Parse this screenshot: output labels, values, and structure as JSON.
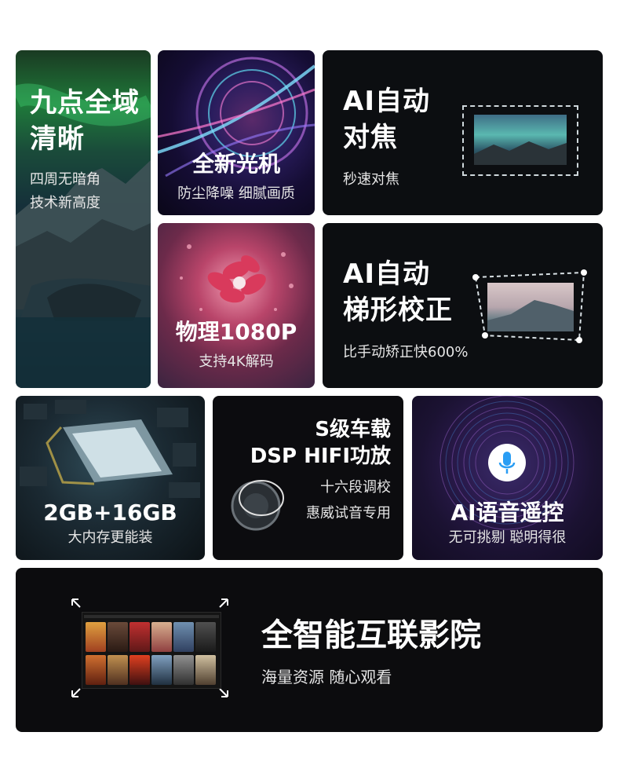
{
  "cards": {
    "clarity": {
      "title_line1": "九点全域",
      "title_line2": "清晰",
      "sub_line1": "四周无暗角",
      "sub_line2": "技术新高度"
    },
    "optics": {
      "title": "全新光机",
      "sub": "防尘降噪 细腻画质"
    },
    "autofocus": {
      "title_line1": "AI自动",
      "title_line2": "对焦",
      "sub": "秒速对焦"
    },
    "resolution": {
      "title": "物理1080P",
      "sub": "支持4K解码"
    },
    "keystone": {
      "title_line1": "AI自动",
      "title_line2": "梯形校正",
      "sub": "比手动矫正快600%"
    },
    "memory": {
      "title": "2GB+16GB",
      "sub": "大内存更能装"
    },
    "audio": {
      "title_line1": "S级车载",
      "title_line2": "DSP HIFI功放",
      "sub_line1": "十六段调校",
      "sub_line2": "惠威试音专用"
    },
    "voice": {
      "title": "AI语音遥控",
      "sub": "无可挑剔 聪明得很",
      "icon": "microphone-icon"
    },
    "smart": {
      "title": "全智能互联影院",
      "sub": "海量资源 随心观看"
    }
  },
  "colors": {
    "card_bg": "#0c0e11",
    "accent_blue": "#2a9df4",
    "text": "#ffffff",
    "sub_text": "#e6e6e6"
  }
}
